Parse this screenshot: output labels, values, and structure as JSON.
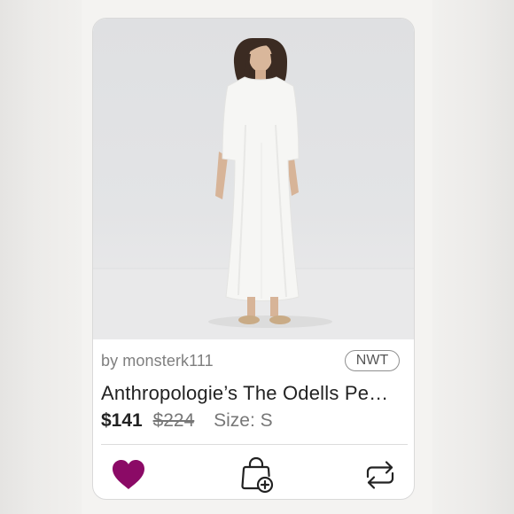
{
  "listing": {
    "seller": "by monsterk111",
    "condition_badge": "NWT",
    "title": "Anthropologie’s The Odells Pe…",
    "price": "$141",
    "original_price": "$224",
    "size": "Size: S"
  },
  "actions": {
    "like_icon": "heart-icon",
    "bundle_icon": "shopping-bag-plus-icon",
    "share_icon": "share-repost-icon"
  },
  "colors": {
    "like_heart": "#8b0a66",
    "text_primary": "#222222",
    "text_secondary": "#7f7f7f"
  }
}
